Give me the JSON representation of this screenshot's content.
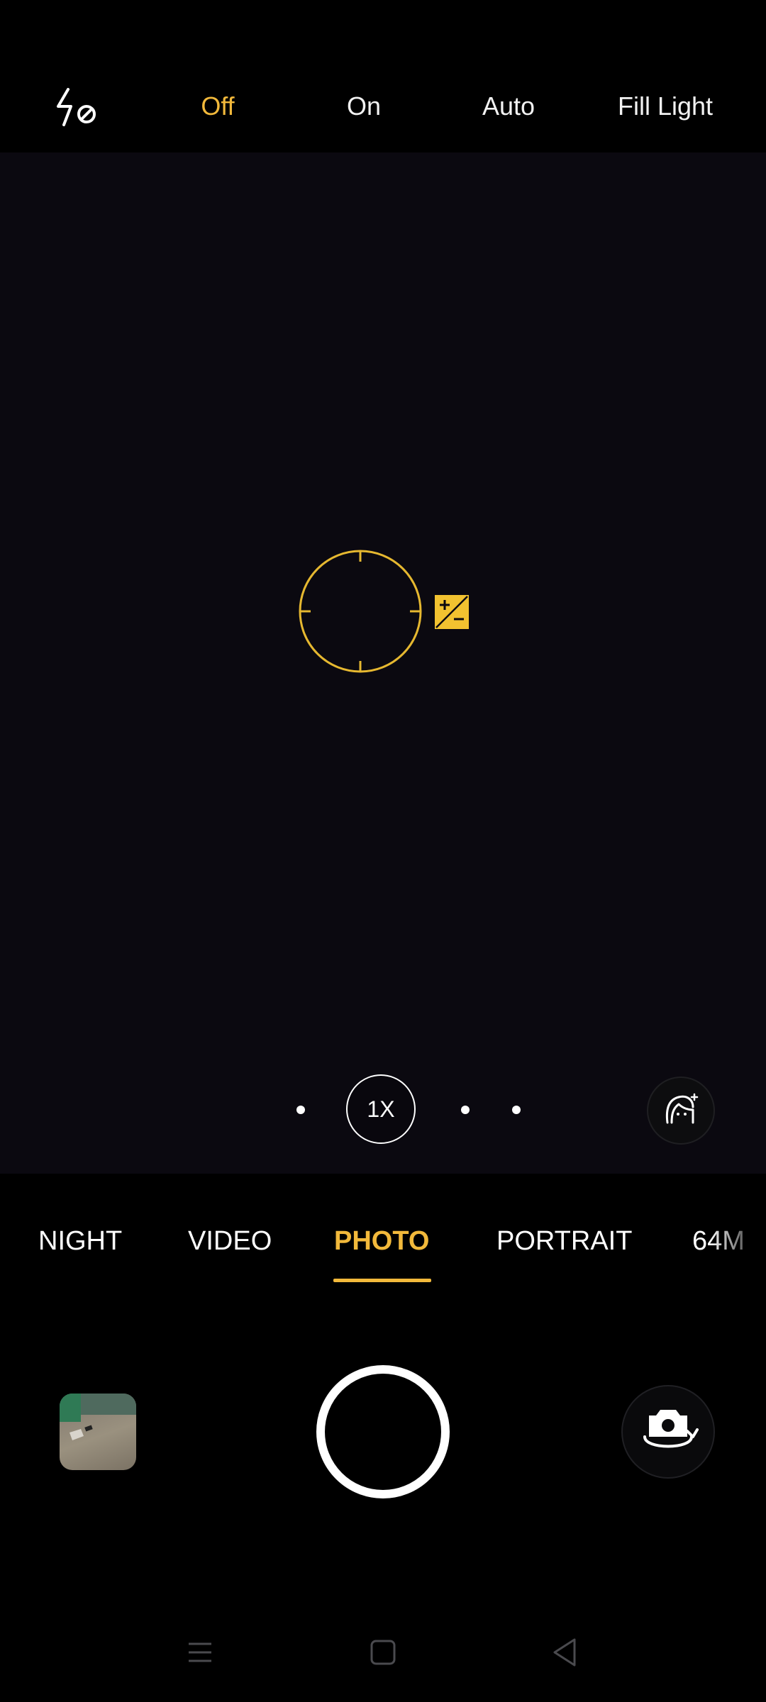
{
  "flash": {
    "icon": "flash-off-icon",
    "options": [
      "Off",
      "On",
      "Auto",
      "Fill Light"
    ],
    "selected": "Off"
  },
  "viewfinder": {
    "focus_icon": "focus-ring-icon",
    "exposure_icon": "exposure-compensation-icon"
  },
  "zoom": {
    "label": "1X"
  },
  "modes": {
    "items": [
      "NIGHT",
      "VIDEO",
      "PHOTO",
      "PORTRAIT",
      "64M"
    ],
    "selected": "PHOTO"
  },
  "controls": {
    "gallery_icon": "gallery-thumbnail",
    "shutter_icon": "shutter-button",
    "switch_icon": "switch-camera-icon",
    "beauty_icon": "beauty-face-icon"
  },
  "navigation": {
    "icons": [
      "menu-icon",
      "home-icon",
      "back-icon"
    ]
  },
  "colors": {
    "accent": "#f2b93b",
    "viewfinder_bg": "#0b0910",
    "bar_bg": "#000000"
  }
}
